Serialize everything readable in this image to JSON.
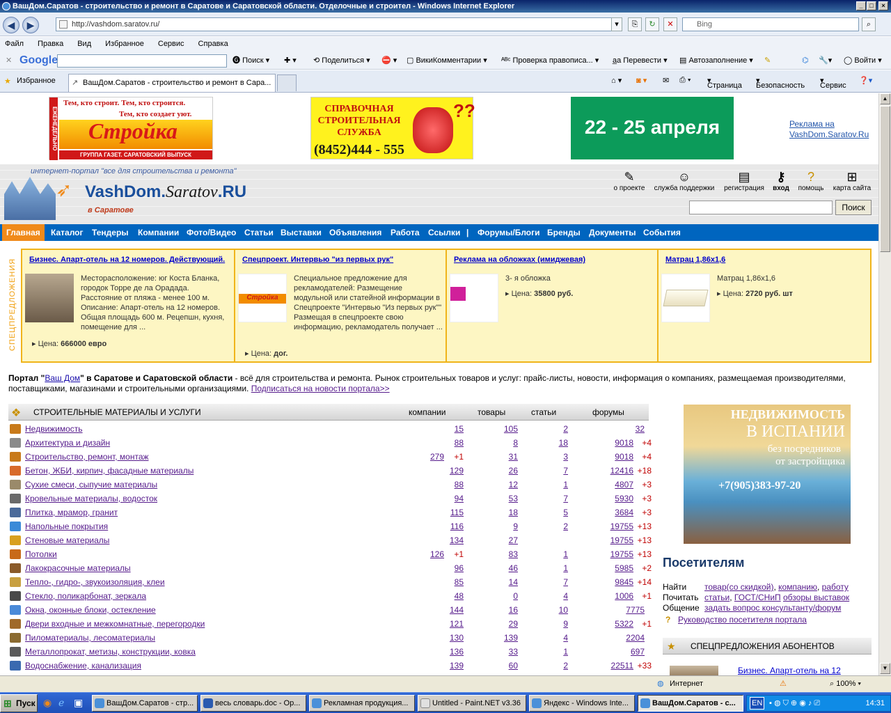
{
  "window": {
    "title": "ВашДом.Саратов - строительство и ремонт в Саратове и Саратовской области. Отделочные и строител - Windows Internet Explorer",
    "controls": [
      "_",
      "□",
      "×"
    ]
  },
  "address_bar": {
    "url": "http://vashdom.saratov.ru/",
    "search_placeholder": "Bing"
  },
  "menu": [
    "Файл",
    "Правка",
    "Вид",
    "Избранное",
    "Сервис",
    "Справка"
  ],
  "google_toolbar": {
    "logo": "Google",
    "items": [
      "Поиск",
      "Поделиться",
      "ВикиКомментарии",
      "Проверка правописа...",
      "Перевести",
      "Автозаполнение",
      "Войти"
    ]
  },
  "favorites_bar": {
    "label": "Избранное",
    "tab_title": "ВашДом.Саратов - строительство и ремонт в Сара...",
    "tools": [
      "Страница",
      "Безопасность",
      "Сервис"
    ]
  },
  "banners": {
    "stroika_line1": "Тем, кто строит.  Тем, кто строится.",
    "stroika_line2": "Тем, кто создает уют.",
    "stroika_logo": "Стройка",
    "stroika_side": "ЕЖЕНЕДЕЛЬНО",
    "stroika_bottom": "ГРУППА ГАЗЕТ. САРАТОВСКИЙ ВЫПУСК",
    "help_title": "СПРАВОЧНАЯ СТРОИТЕЛЬНАЯ СЛУЖБА",
    "help_phone": "(8452)444 - 555",
    "dates": "22 - 25 апреля",
    "ad_link": "Реклама на VashDom.Saratov.Ru"
  },
  "header": {
    "tagline": "интернет-портал \"все для строительства и ремонта\"",
    "logo_main": "VashDom.",
    "logo_city": "Saratov",
    "logo_ru": ".RU",
    "logo_sub": "в Саратове",
    "links": [
      "о проекте",
      "служба поддержки",
      "регистрация",
      "вход",
      "помощь",
      "карта сайта"
    ],
    "search_button": "Поиск"
  },
  "nav": [
    "Главная",
    "Каталог",
    "Тендеры",
    "Компании",
    "Фото/Видео",
    "Статьи",
    "Выставки",
    "Объявления",
    "Работа",
    "Ссылки",
    "|",
    "Форумы/Блоги",
    "Бренды",
    "Документы",
    "События"
  ],
  "special": {
    "side_label": "СПЕЦПРЕДЛОЖЕНИЯ",
    "items": [
      {
        "title": "Бизнес. Апарт-отель на 12 номеров. Действующий.",
        "desc": "Месторасположение: юг Коста Бланка, городок Торре де ла Орадада. Расстояние от пляжа - менее 100 м. Описание: Апарт-отель на 12 номеров. Общая площадь 600 м. Рецепшн, кухня, помещение для ...",
        "price_label": "Цена:",
        "price": "666000 евро"
      },
      {
        "title": "Спецпроект. Интервью \"из первых рук\"",
        "desc": "Специальное предложение для рекламодателей: Размещение модульной или статейной информации в Спецпроекте \"Интервью \"Из первых рук\"\" Размещая в спецпроекте свою информацию, рекламодатель получает ...",
        "price_label": "Цена:",
        "price": "дог."
      },
      {
        "title": "Реклама на обложках (имиджевая)",
        "desc": "3- я обложка",
        "price_label": "Цена:",
        "price": "35800 руб."
      },
      {
        "title": "Матрац 1,86х1,6",
        "desc": "Матрац 1,86х1,6",
        "price_label": "Цена:",
        "price": "2720 руб. шт"
      }
    ]
  },
  "intro": {
    "prefix": "Портал \"",
    "brand": "Ваш Дом",
    "mid": "\" в Саратове и Саратовской области",
    "text": " - всё для строительства и ремонта. Рынок строительных товаров и услуг: прайс-листы, новости, информация о компаниях, размещаемая производителями, поставщиками, магазинами и строительными организациями.",
    "subscribe": "Подписаться на новости портала>>"
  },
  "table": {
    "title": "СТРОИТЕЛЬНЫЕ МАТЕРИАЛЫ И УСЛУГИ",
    "columns": [
      "компании",
      "товары",
      "статьи",
      "форумы"
    ],
    "rows": [
      {
        "name": "Недвижимость",
        "c": "15",
        "c_plus": "",
        "g": "105",
        "s": "2",
        "f": "32",
        "f_plus": ""
      },
      {
        "name": "Архитектура и дизайн",
        "c": "88",
        "c_plus": "",
        "g": "8",
        "s": "18",
        "f": "9018",
        "f_plus": "+4"
      },
      {
        "name": "Строительство, ремонт, монтаж",
        "c": "279",
        "c_plus": "+1",
        "g": "31",
        "s": "3",
        "f": "9018",
        "f_plus": "+4"
      },
      {
        "name": "Бетон, ЖБИ, кирпич, фасадные материалы",
        "c": "129",
        "c_plus": "",
        "g": "26",
        "s": "7",
        "f": "12416",
        "f_plus": "+18"
      },
      {
        "name": "Сухие смеси, сыпучие материалы",
        "c": "88",
        "c_plus": "",
        "g": "12",
        "s": "1",
        "f": "4807",
        "f_plus": "+3"
      },
      {
        "name": "Кровельные материалы, водосток",
        "c": "94",
        "c_plus": "",
        "g": "53",
        "s": "7",
        "f": "5930",
        "f_plus": "+3"
      },
      {
        "name": "Плитка, мрамор, гранит",
        "c": "115",
        "c_plus": "",
        "g": "18",
        "s": "5",
        "f": "3684",
        "f_plus": "+3"
      },
      {
        "name": "Напольные покрытия",
        "c": "116",
        "c_plus": "",
        "g": "9",
        "s": "2",
        "f": "19755",
        "f_plus": "+13"
      },
      {
        "name": "Стеновые материалы",
        "c": "134",
        "c_plus": "",
        "g": "27",
        "s": "",
        "f": "19755",
        "f_plus": "+13"
      },
      {
        "name": "Потолки",
        "c": "126",
        "c_plus": "+1",
        "g": "83",
        "s": "1",
        "f": "19755",
        "f_plus": "+13"
      },
      {
        "name": "Лакокрасочные материалы",
        "c": "96",
        "c_plus": "",
        "g": "46",
        "s": "1",
        "f": "5985",
        "f_plus": "+2"
      },
      {
        "name": "Тепло-, гидро-, звукоизоляция, клеи",
        "c": "85",
        "c_plus": "",
        "g": "14",
        "s": "7",
        "f": "9845",
        "f_plus": "+14"
      },
      {
        "name": "Стекло, поликарбонат, зеркала",
        "c": "48",
        "c_plus": "",
        "g": "0",
        "s": "4",
        "f": "1006",
        "f_plus": "+1"
      },
      {
        "name": "Окна, оконные блоки, остекление",
        "c": "144",
        "c_plus": "",
        "g": "16",
        "s": "10",
        "f": "7775",
        "f_plus": ""
      },
      {
        "name": "Двери входные и межкомнатные, перегородки",
        "c": "121",
        "c_plus": "",
        "g": "29",
        "s": "9",
        "f": "5322",
        "f_plus": "+1"
      },
      {
        "name": "Пиломатериалы, лесоматериалы",
        "c": "130",
        "c_plus": "",
        "g": "139",
        "s": "4",
        "f": "2204",
        "f_plus": ""
      },
      {
        "name": "Металлопрокат, метизы, конструкции, ковка",
        "c": "136",
        "c_plus": "",
        "g": "33",
        "s": "1",
        "f": "697",
        "f_plus": ""
      },
      {
        "name": "Водоснабжение, канализация",
        "c": "139",
        "c_plus": "",
        "g": "60",
        "s": "2",
        "f": "22511",
        "f_plus": "+33"
      }
    ]
  },
  "right": {
    "ad_title1": "НЕДВИЖИМОСТЬ",
    "ad_title2": "В ИСПАНИИ",
    "ad_sub1": "без посредников",
    "ad_sub2": "от застройщика",
    "ad_phone": "+7(905)383-97-20",
    "visitors_title": "Посетителям",
    "find_label": "Найти",
    "find_links": [
      "товар",
      "(со скидкой)",
      ", ",
      "компанию",
      ", ",
      "работу"
    ],
    "read_label": "Почитать",
    "read_links": [
      "статьи",
      ", ",
      "ГОСТ/СНиП",
      " ",
      "обзоры выставок"
    ],
    "talk_label": "Общение",
    "talk_link": "задать вопрос консультанту/форум",
    "guide_link": "Руководство посетителя портала",
    "subscribers_title": "СПЕЦПРЕДЛОЖЕНИЯ АБОНЕНТОВ",
    "sub_item": "Бизнес. Апарт-отель на 12"
  },
  "statusbar": {
    "zone": "Интернет",
    "zoom": "100%"
  },
  "taskbar": {
    "start": "Пуск",
    "tasks": [
      "ВашДом.Саратов - стр...",
      "весь словарь.doc - Ор...",
      "Рекламная продукция...",
      "Untitled - Paint.NET v3.36",
      "Яндекс - Windows Inte...",
      "ВашДом.Саратов - с..."
    ],
    "lang": "EN",
    "clock": "14:31"
  },
  "colors": {
    "nav": "#0065bf",
    "nav_active": "#f08a1a",
    "spec_border": "#f0b41a",
    "spec_bg": "#fdf6c3"
  }
}
